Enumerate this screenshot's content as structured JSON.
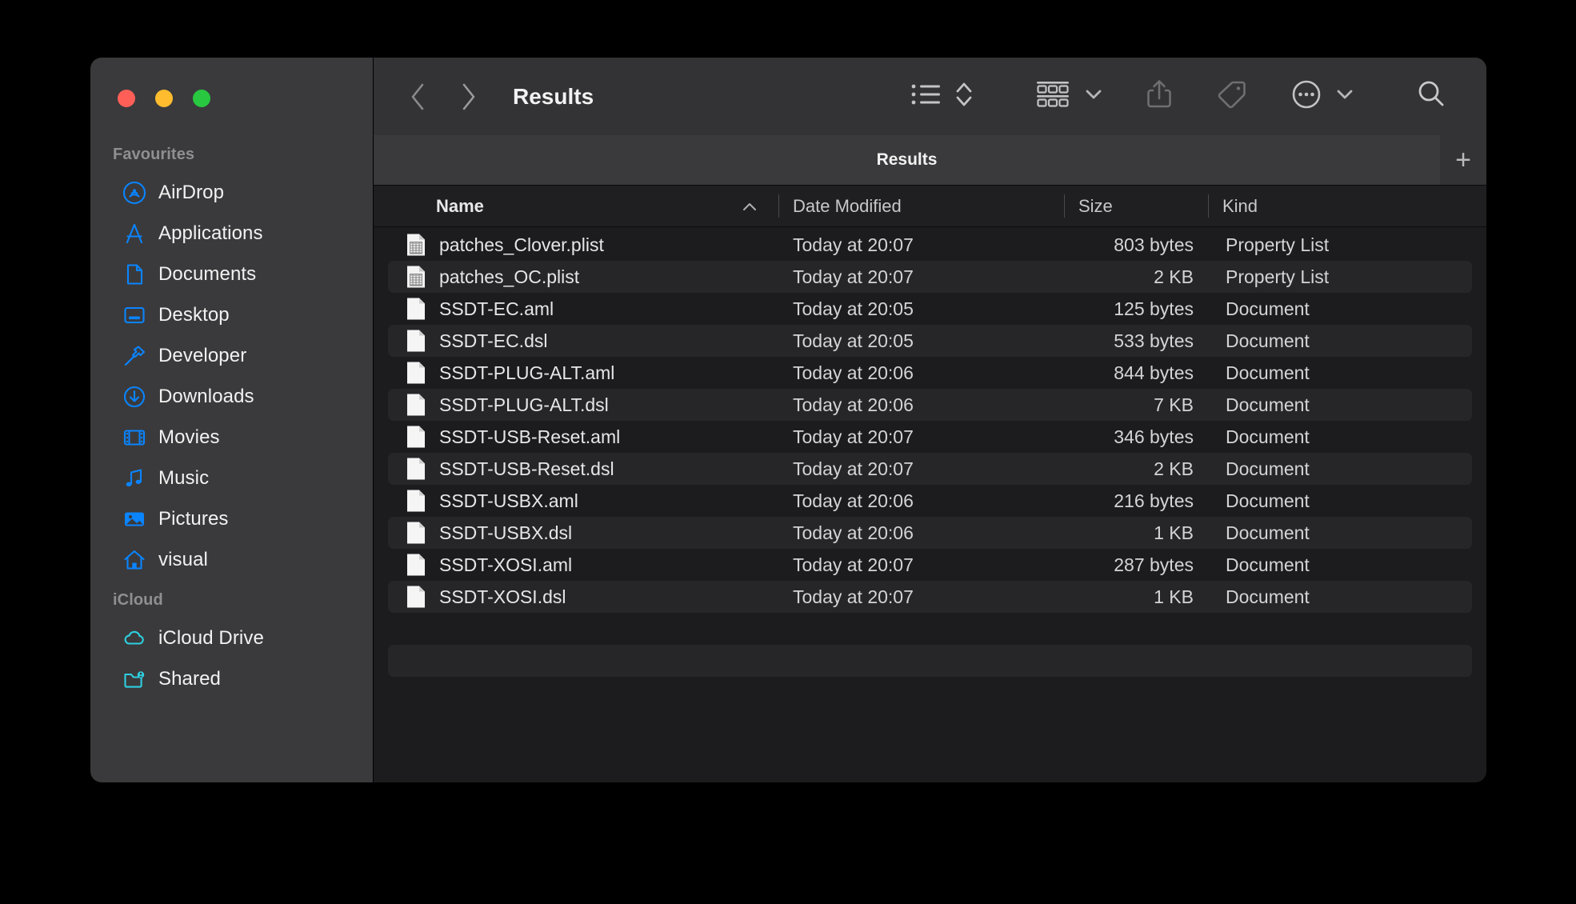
{
  "window": {
    "traffic_lights": [
      {
        "name": "close",
        "color": "#ff5f57"
      },
      {
        "name": "minimize",
        "color": "#febc2e"
      },
      {
        "name": "maximize",
        "color": "#28c840"
      }
    ]
  },
  "sidebar": {
    "sections": [
      {
        "title": "Favourites",
        "items": [
          {
            "label": "AirDrop",
            "icon": "airdrop-icon",
            "color": "#0a84ff"
          },
          {
            "label": "Applications",
            "icon": "applications-icon",
            "color": "#0a84ff"
          },
          {
            "label": "Documents",
            "icon": "documents-icon",
            "color": "#0a84ff"
          },
          {
            "label": "Desktop",
            "icon": "desktop-icon",
            "color": "#0a84ff"
          },
          {
            "label": "Developer",
            "icon": "hammer-icon",
            "color": "#0a84ff"
          },
          {
            "label": "Downloads",
            "icon": "downloads-icon",
            "color": "#0a84ff"
          },
          {
            "label": "Movies",
            "icon": "movies-icon",
            "color": "#0a84ff"
          },
          {
            "label": "Music",
            "icon": "music-note-icon",
            "color": "#0a84ff"
          },
          {
            "label": "Pictures",
            "icon": "pictures-icon",
            "color": "#0a84ff"
          },
          {
            "label": "visual",
            "icon": "home-icon",
            "color": "#0a84ff"
          }
        ]
      },
      {
        "title": "iCloud",
        "items": [
          {
            "label": "iCloud Drive",
            "icon": "cloud-icon",
            "color": "#2ecfe0"
          },
          {
            "label": "Shared",
            "icon": "shared-folder-icon",
            "color": "#2ecfe0"
          }
        ]
      }
    ]
  },
  "toolbar": {
    "back_icon": "chevron-left-icon",
    "forward_icon": "chevron-right-icon",
    "title": "Results",
    "buttons": [
      {
        "name": "view-as-list-button",
        "icon": "list-view-icon"
      },
      {
        "name": "view-options-stepper",
        "icon": "chevron-up-down-icon"
      },
      {
        "name": "group-by-button",
        "icon": "grid-group-icon"
      },
      {
        "name": "group-by-chevron",
        "icon": "chevron-down-icon"
      },
      {
        "name": "share-button",
        "icon": "share-icon"
      },
      {
        "name": "tag-button",
        "icon": "tag-icon"
      },
      {
        "name": "more-actions-button",
        "icon": "ellipsis-circle-icon"
      },
      {
        "name": "more-actions-chevron",
        "icon": "chevron-down-icon"
      },
      {
        "name": "search-button",
        "icon": "search-icon"
      }
    ]
  },
  "tabbar": {
    "active_tab": "Results",
    "new_tab_label": "+"
  },
  "columns": {
    "name": "Name",
    "date_modified": "Date Modified",
    "size": "Size",
    "kind": "Kind",
    "sort_indicator": "ascending"
  },
  "files": [
    {
      "name": "patches_Clover.plist",
      "date": "Today at 20:07",
      "size": "803 bytes",
      "kind": "Property List",
      "icon": "plist-file-icon"
    },
    {
      "name": "patches_OC.plist",
      "date": "Today at 20:07",
      "size": "2 KB",
      "kind": "Property List",
      "icon": "plist-file-icon"
    },
    {
      "name": "SSDT-EC.aml",
      "date": "Today at 20:05",
      "size": "125 bytes",
      "kind": "Document",
      "icon": "blank-file-icon"
    },
    {
      "name": "SSDT-EC.dsl",
      "date": "Today at 20:05",
      "size": "533 bytes",
      "kind": "Document",
      "icon": "blank-file-icon"
    },
    {
      "name": "SSDT-PLUG-ALT.aml",
      "date": "Today at 20:06",
      "size": "844 bytes",
      "kind": "Document",
      "icon": "blank-file-icon"
    },
    {
      "name": "SSDT-PLUG-ALT.dsl",
      "date": "Today at 20:06",
      "size": "7 KB",
      "kind": "Document",
      "icon": "blank-file-icon"
    },
    {
      "name": "SSDT-USB-Reset.aml",
      "date": "Today at 20:07",
      "size": "346 bytes",
      "kind": "Document",
      "icon": "blank-file-icon"
    },
    {
      "name": "SSDT-USB-Reset.dsl",
      "date": "Today at 20:07",
      "size": "2 KB",
      "kind": "Document",
      "icon": "blank-file-icon"
    },
    {
      "name": "SSDT-USBX.aml",
      "date": "Today at 20:06",
      "size": "216 bytes",
      "kind": "Document",
      "icon": "blank-file-icon"
    },
    {
      "name": "SSDT-USBX.dsl",
      "date": "Today at 20:06",
      "size": "1 KB",
      "kind": "Document",
      "icon": "blank-file-icon"
    },
    {
      "name": "SSDT-XOSI.aml",
      "date": "Today at 20:07",
      "size": "287 bytes",
      "kind": "Document",
      "icon": "blank-file-icon"
    },
    {
      "name": "SSDT-XOSI.dsl",
      "date": "Today at 20:07",
      "size": "1 KB",
      "kind": "Document",
      "icon": "blank-file-icon"
    }
  ],
  "empty_rows": 2
}
